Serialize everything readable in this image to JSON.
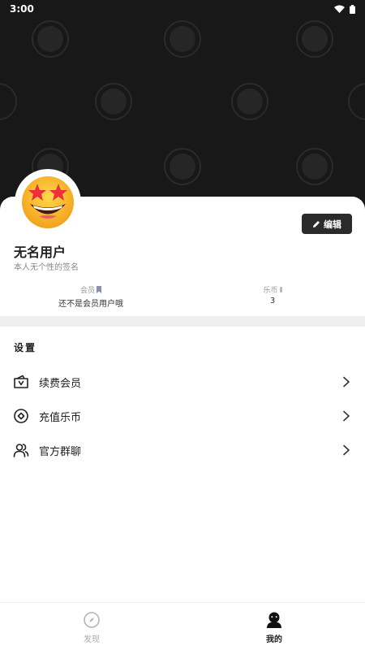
{
  "status_bar": {
    "time": "3:00"
  },
  "profile": {
    "edit_label": "编辑",
    "username": "无名用户",
    "signature": "本人无个性的签名"
  },
  "stats": {
    "vip": {
      "label": "会员",
      "value": "还不是会员用户哦"
    },
    "coin": {
      "label": "乐币",
      "value": "3"
    }
  },
  "settings": {
    "title": "设置",
    "items": [
      {
        "label": "续费会员",
        "icon": "vip-wallet-icon"
      },
      {
        "label": "充值乐币",
        "icon": "coin-icon"
      },
      {
        "label": "官方群聊",
        "icon": "group-chat-icon"
      }
    ]
  },
  "bottom_nav": {
    "items": [
      {
        "label": "发现",
        "icon": "compass-icon",
        "active": false
      },
      {
        "label": "我的",
        "icon": "user-icon",
        "active": true
      }
    ]
  },
  "colors": {
    "banner": "#181818",
    "accent_dark": "#2b2b2b",
    "muted": "#888888",
    "divider": "#efefef"
  }
}
